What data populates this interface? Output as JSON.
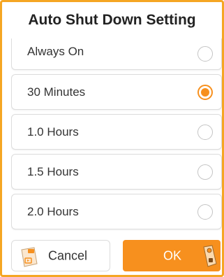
{
  "dialog": {
    "title": "Auto Shut Down Setting",
    "options": [
      {
        "label": "Always On",
        "selected": false
      },
      {
        "label": "30 Minutes",
        "selected": true
      },
      {
        "label": "1.0 Hours",
        "selected": false
      },
      {
        "label": "1.5 Hours",
        "selected": false
      },
      {
        "label": "2.0 Hours",
        "selected": false
      }
    ],
    "cancel_label": "Cancel",
    "ok_label": "OK",
    "cancel_icon": "remote-control-icon",
    "ok_icon": "device-watermark-icon"
  },
  "colors": {
    "accent": "#f7901e",
    "frame_border": "#f5a623"
  }
}
